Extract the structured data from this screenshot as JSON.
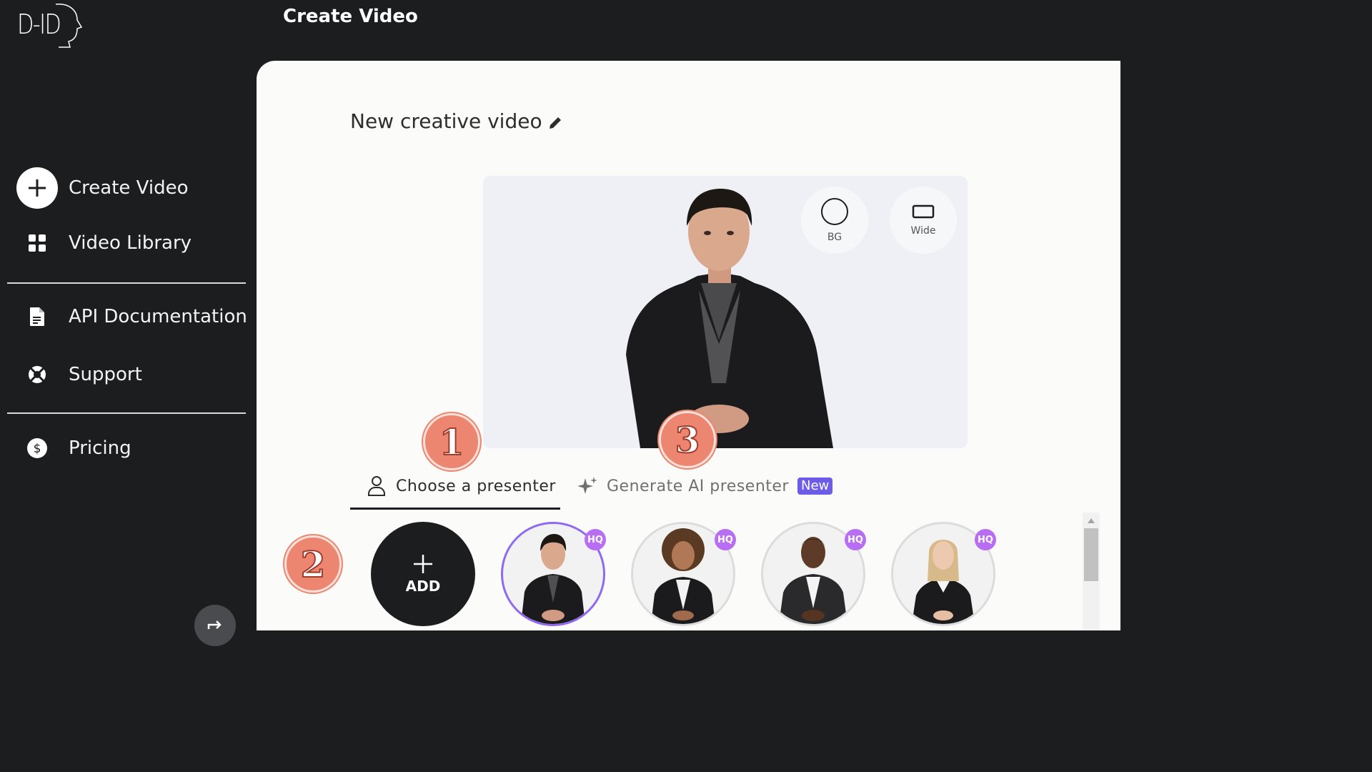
{
  "brand": {
    "logo_text": "D-ID"
  },
  "header": {
    "title": "Create Video"
  },
  "sidebar": {
    "items": [
      {
        "label": "Create Video",
        "icon": "plus-icon"
      },
      {
        "label": "Video Library",
        "icon": "grid-icon"
      },
      {
        "label": "API Documentation",
        "icon": "document-icon"
      },
      {
        "label": "Support",
        "icon": "lifebuoy-icon"
      },
      {
        "label": "Pricing",
        "icon": "dollar-icon"
      }
    ]
  },
  "editor": {
    "video_title": "New creative video",
    "preview_controls": {
      "bg_label": "BG",
      "wide_label": "Wide"
    },
    "tabs": {
      "choose_presenter": "Choose a presenter",
      "generate_ai": "Generate AI presenter",
      "new_badge": "New"
    },
    "add_label": "ADD",
    "presenters": [
      {
        "badge": "HQ",
        "selected": true
      },
      {
        "badge": "HQ",
        "selected": false
      },
      {
        "badge": "HQ",
        "selected": false
      },
      {
        "badge": "HQ",
        "selected": false
      }
    ]
  },
  "annotations": {
    "one": "1",
    "two": "2",
    "three": "3"
  },
  "colors": {
    "sidebar_bg": "#1c1d1f",
    "main_bg": "#fbfbfa",
    "accent_purple": "#8f6af0",
    "new_badge": "#6c5ce7",
    "annotation": "#ec8670"
  }
}
